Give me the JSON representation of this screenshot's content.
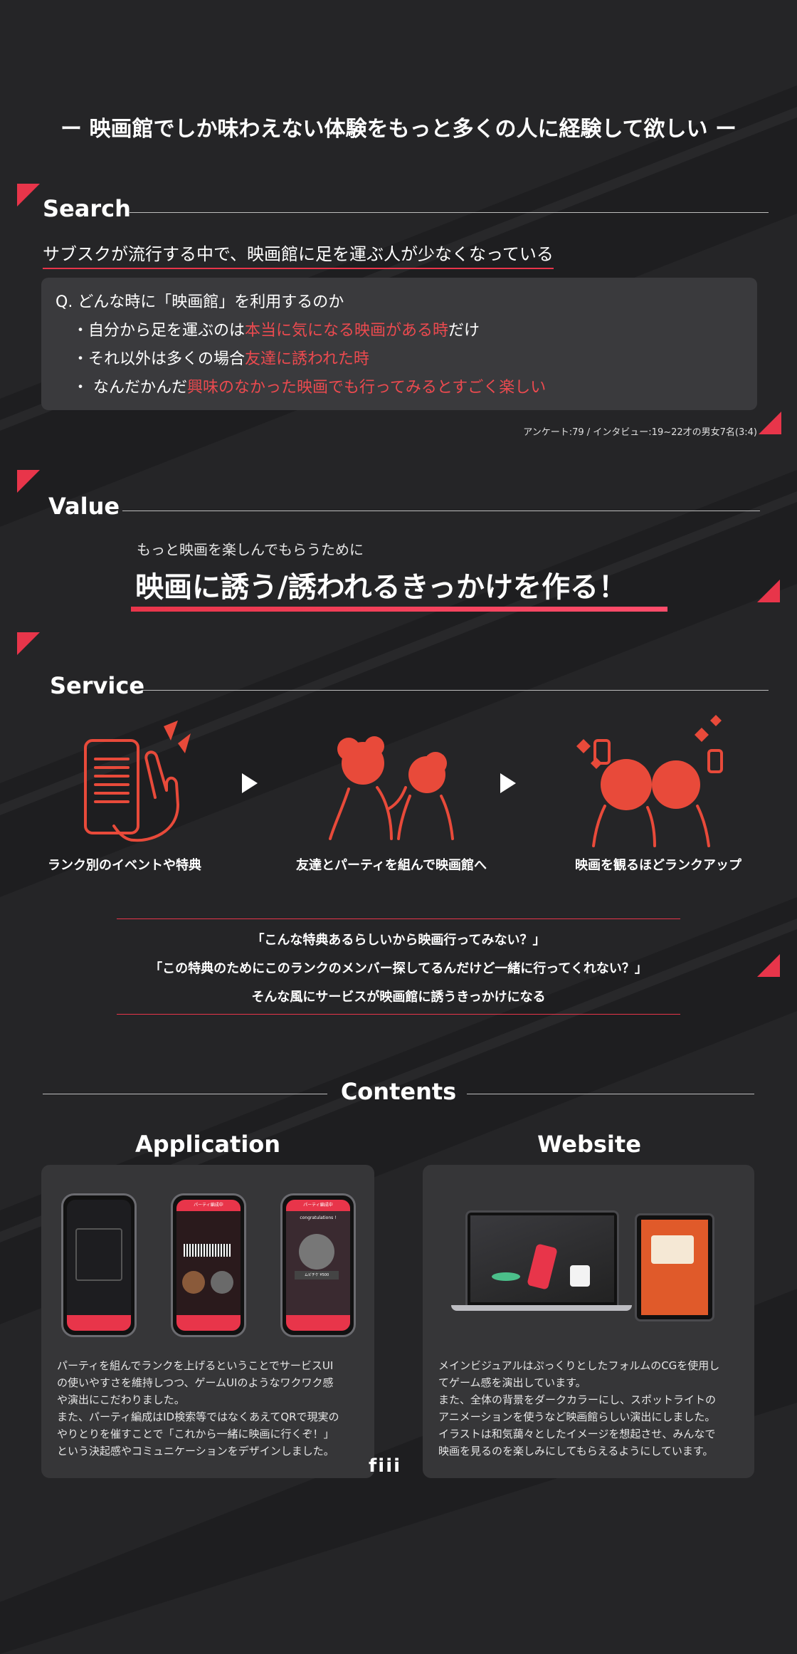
{
  "tagline": "ー 映画館でしか味わえない体験をもっと多くの人に経験して欲しい ー",
  "search": {
    "heading": "Search",
    "lead": "サブスクが流行する中で、映画館に足を運ぶ人が少なくなっている",
    "question": "Q. どんな時に「映画館」を利用するのか",
    "answers": [
      {
        "bullet": "・",
        "plain": "自分から足を運ぶのは",
        "highlight": "本当に気になる映画がある時",
        "suffix": "だけ"
      },
      {
        "bullet": "・",
        "plain": "それ以外は多くの場合",
        "highlight": "友達に誘われた時",
        "suffix": ""
      },
      {
        "bullet": "・",
        "plain": " なんだかんだ",
        "highlight": "興味のなかった映画でも行ってみるとすごく楽しい",
        "suffix": ""
      }
    ],
    "source": "アンケート:79 / インタビュー:19~22才の男女7名(3:4)"
  },
  "value": {
    "heading": "Value",
    "sub": "もっと映画を楽しんでもらうために",
    "main": "映画に誘う/誘われるきっかけを作る！"
  },
  "service": {
    "heading": "Service",
    "steps": [
      {
        "label": "ランク別のイベントや特典",
        "icon": "phone-hand-icon"
      },
      {
        "label": "友達とパーティを組んで映画館へ",
        "icon": "friends-icon"
      },
      {
        "label": "映画を観るほどランクアップ",
        "icon": "celebrate-icon"
      }
    ],
    "quotes": [
      "「こんな特典あるらしいから映画行ってみない？」",
      "「この特典のためにこのランクのメンバー探してるんだけど一緒に行ってくれない？」",
      "そんな風にサービスが映画館に誘うきっかけになる"
    ]
  },
  "contents": {
    "heading": "Contents",
    "application": {
      "title": "Application",
      "text": [
        "パーティを組んでランクを上げるということでサービスUI",
        "の使いやすさを維持しつつ、ゲームUIのようなワクワク感",
        "や演出にこだわりました。",
        "また、パーティ編成はID検索等ではなくあえてQRで現実の",
        "やりとりを催すことで「これから一緒に映画に行くぞ！」",
        "という決起感やコミュニケーションをデザインしました。"
      ],
      "phone_titles": [
        "パーティ編成中",
        "パーティ編成中"
      ],
      "phone_texts": [
        "congratulations !",
        "ムビチケ ¥500"
      ]
    },
    "website": {
      "title": "Website",
      "text": [
        "メインビジュアルはぷっくりとしたフォルムのCGを使用し",
        "てゲーム感を演出しています。",
        "また、全体の背景をダークカラーにし、スポットライトの",
        "アニメーションを使うなど映画館らしい演出にしました。",
        "イラストは和気藹々としたイメージを想起させ、みんなで",
        "映画を見るのを楽しみにしてもらえるようにしています。"
      ]
    },
    "logo": "fiii"
  },
  "colors": {
    "accent": "#e8354a",
    "background": "#252527",
    "panel": "#3a3a3d"
  }
}
